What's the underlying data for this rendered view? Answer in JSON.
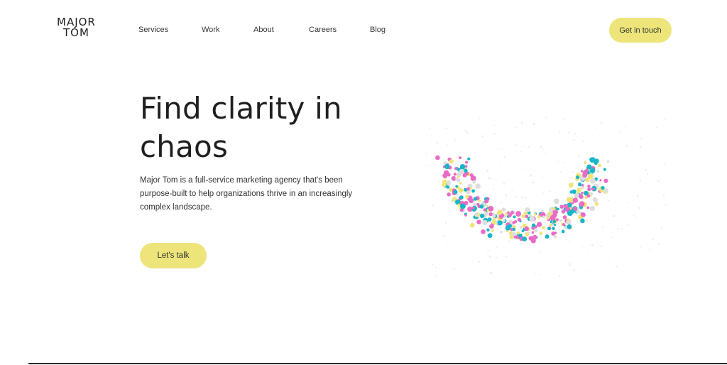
{
  "header": {
    "logo_line1": "MAJOR",
    "logo_line2": "TOM",
    "nav": [
      "Services",
      "Work",
      "About",
      "Careers",
      "Blog"
    ],
    "cta_label": "Get in touch"
  },
  "hero": {
    "title_line1": "Find clarity in",
    "title_line2": "chaos",
    "description": "Major Tom is a full-service marketing agency that's been purpose-built to help organizations thrive in an increasingly complex landscape.",
    "cta_label": "Let's talk"
  },
  "colors": {
    "accent": "#ede57a",
    "text": "#1f1f1f",
    "dot_pink": "#e96bc5",
    "dot_cyan": "#17b6c8",
    "dot_yellow": "#f0e477",
    "dot_gray": "#dedede"
  }
}
